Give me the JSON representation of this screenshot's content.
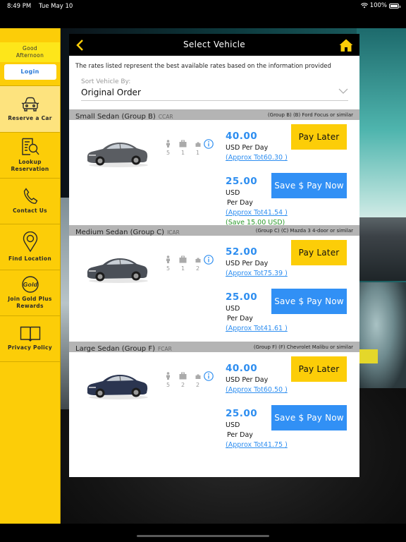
{
  "status_bar": {
    "time": "8:49 PM",
    "date": "Tue May 10",
    "battery": "100%",
    "battery_level": 1.0
  },
  "sidebar": {
    "greeting_line1": "Good",
    "greeting_line2": "Afternoon",
    "login_label": "Login",
    "items": [
      {
        "label": "Reserve a Car",
        "icon": "car-icon",
        "active": true
      },
      {
        "label_line1": "Lookup",
        "label_line2": "Reservation",
        "icon": "document-search-icon"
      },
      {
        "label": "Contact Us",
        "icon": "phone-icon"
      },
      {
        "label": "Find Location",
        "icon": "location-pin-icon"
      },
      {
        "label_line1": "Join Gold Plus",
        "label_line2": "Rewards",
        "icon": "gold-badge-icon",
        "badge_text": "Gold"
      },
      {
        "label": "Privacy Policy",
        "icon": "book-icon"
      }
    ]
  },
  "header": {
    "title": "Select Vehicle",
    "back_icon": "chevron-left-icon",
    "home_icon": "home-icon"
  },
  "disclaimer": "The rates listed represent the best available rates based on the information provided",
  "sort": {
    "label": "Sort Vehicle By:",
    "value": "Original Order"
  },
  "vehicles": [
    {
      "name": "Small Sedan (Group B)",
      "code": "CCAR",
      "similar": "(Group B) (B) Ford Focus or similar",
      "passengers": "5",
      "large_bags": "1",
      "small_bags": "1",
      "color": "#5a5d62",
      "pay_later": {
        "amount": "40.00",
        "unit": "USD Per Day",
        "approx": "(Approx Tot60.30 )",
        "button": "Pay Later"
      },
      "pay_now": {
        "amount": "25.00",
        "currency": "USD",
        "unit": "Per Day",
        "approx": "(Approx Tot41.54 )",
        "save": "(Save 15.00 USD)",
        "button": "Save $ Pay Now"
      }
    },
    {
      "name": "Medium Sedan (Group C)",
      "code": "ICAR",
      "similar": "(Group C) (C) Mazda 3 4-door or similar",
      "passengers": "5",
      "large_bags": "1",
      "small_bags": "2",
      "color": "#4a4f57",
      "pay_later": {
        "amount": "52.00",
        "unit": "USD Per Day",
        "approx": "(Approx Tot75.39 )",
        "button": "Pay Later"
      },
      "pay_now": {
        "amount": "25.00",
        "currency": "USD",
        "unit": "Per Day",
        "approx": "(Approx Tot41.61 )",
        "button": "Save $ Pay Now"
      }
    },
    {
      "name": "Large Sedan (Group F)",
      "code": "FCAR",
      "similar": "(Group F) (F) Chevrolet Malibu or similar",
      "passengers": "5",
      "large_bags": "2",
      "small_bags": "2",
      "color": "#2b3550",
      "pay_later": {
        "amount": "40.00",
        "unit": "USD Per Day",
        "approx": "(Approx Tot60.50 )",
        "button": "Pay Later"
      },
      "pay_now": {
        "amount": "25.00",
        "currency": "USD",
        "unit": "Per Day",
        "approx": "(Approx Tot41.75 )",
        "button": "Save $ Pay Now"
      }
    }
  ],
  "colors": {
    "brand_yellow": "#fccd08",
    "pay_now_blue": "#3190f5",
    "price_blue": "#2e8ef0",
    "save_green": "#2a9a2a"
  }
}
